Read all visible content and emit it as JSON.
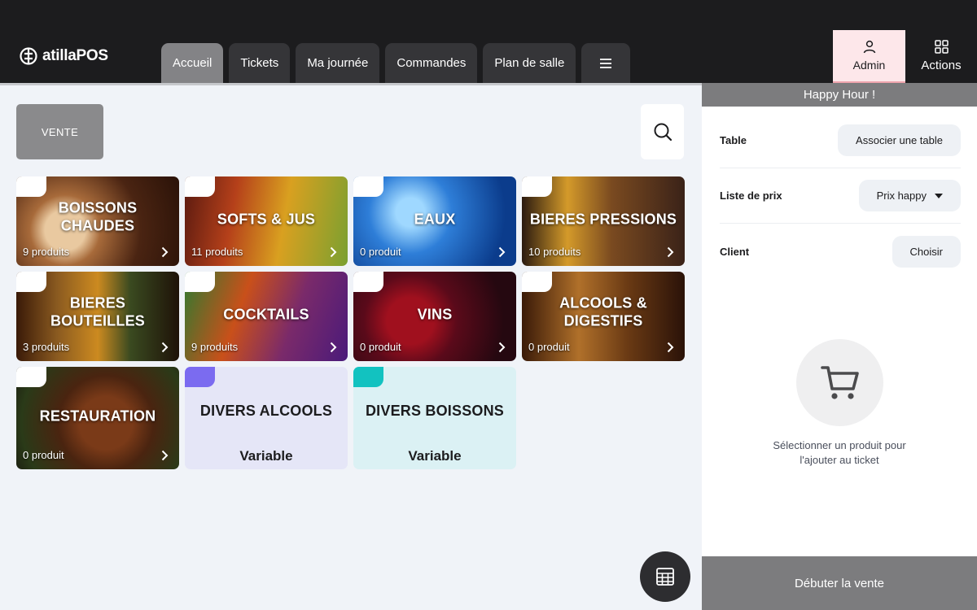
{
  "app": {
    "brand": "atillaPOS",
    "logo_icon": "atilla-logo-icon"
  },
  "tabs": [
    {
      "label": "Accueil",
      "active": true
    },
    {
      "label": "Tickets"
    },
    {
      "label": "Ma journée"
    },
    {
      "label": "Commandes"
    },
    {
      "label": "Plan de salle"
    },
    {
      "label": "",
      "icon": "hamburger-menu-icon"
    }
  ],
  "header": {
    "admin_label": "Admin",
    "admin_icon": "user-icon",
    "actions_label": "Actions",
    "actions_icon": "grid-icon"
  },
  "main": {
    "vente_label": "VENTE",
    "search_icon": "search-icon",
    "calculator_icon": "calculator-icon",
    "categories": [
      {
        "title": "BOISSONS CHAUDES",
        "count": "9 produits"
      },
      {
        "title": "SOFTS & JUS",
        "count": "11 produits"
      },
      {
        "title": "EAUX",
        "count": "0 produit"
      },
      {
        "title": "BIERES PRESSIONS",
        "count": "10 produits"
      },
      {
        "title": "BIERES BOUTEILLES",
        "count": "3 produits"
      },
      {
        "title": "COCKTAILS",
        "count": "9 produits"
      },
      {
        "title": "VINS",
        "count": "0 produit"
      },
      {
        "title": "ALCOOLS & DIGESTIFS",
        "count": "0 produit"
      },
      {
        "title": "RESTAURATION",
        "count": "0 produit"
      },
      {
        "title": "DIVERS ALCOOLS",
        "subtitle": "Variable",
        "accent": "#7b6bf0",
        "bg": "#e5e6f7"
      },
      {
        "title": "DIVERS BOISSONS",
        "subtitle": "Variable",
        "accent": "#12c2c0",
        "bg": "#dbf1f4"
      }
    ]
  },
  "side": {
    "banner": "Happy Hour !",
    "table_label": "Table",
    "table_button": "Associer une table",
    "price_label": "Liste de prix",
    "price_value": "Prix happy",
    "client_label": "Client",
    "client_button": "Choisir",
    "empty_line1": "Sélectionner un produit pour",
    "empty_line2": "l'ajouter au ticket",
    "start_button": "Débuter la vente"
  },
  "colors": {
    "topbar": "#1c1c1e",
    "active_tab": "#838386",
    "admin_bg": "#fde7ea",
    "panel_grey": "#7c7c7e"
  }
}
